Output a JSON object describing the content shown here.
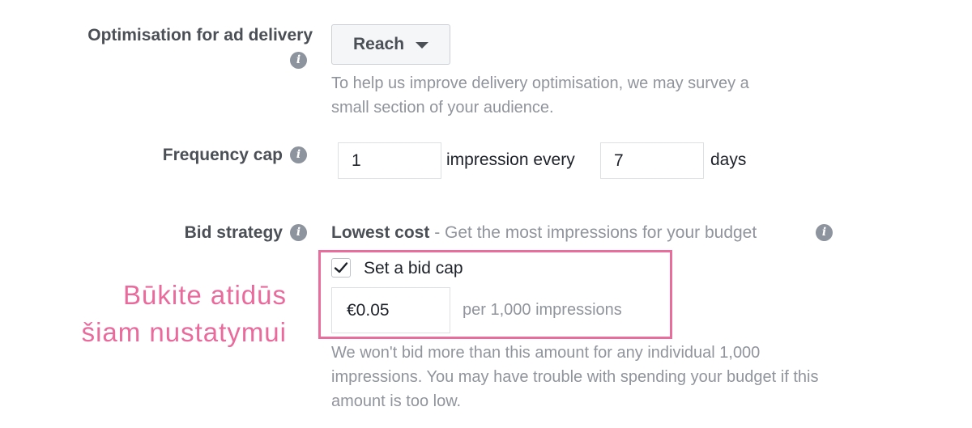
{
  "optimisation": {
    "label": "Optimisation for ad delivery",
    "dropdown_value": "Reach",
    "help_line1": "To help us improve delivery optimisation, we may survey a",
    "help_line2": "small section of your audience."
  },
  "frequency_cap": {
    "label": "Frequency cap",
    "impressions_value": "1",
    "middle_text": "impression every",
    "days_value": "7",
    "unit_text": "days"
  },
  "bid_strategy": {
    "label": "Bid strategy",
    "strategy_name": "Lowest cost",
    "strategy_desc": " - Get the most impressions for your budget",
    "bid_cap_checkbox_label": "Set a bid cap",
    "bid_cap_checked": true,
    "bid_cap_value": "€0.05",
    "bid_cap_unit": "per 1,000 impressions",
    "help_line1": "We won't bid more than this amount for any individual 1,000",
    "help_line2": "impressions. You may have trouble with spending your budget if this",
    "help_line3": "amount is too low."
  },
  "annotation": {
    "line1": "Būkite atidūs",
    "line2": "šiam nustatymui",
    "color": "#ea6a9c"
  },
  "icons": {
    "info": "info-icon",
    "dropdown": "caret-down-icon",
    "check": "checkmark-icon"
  }
}
